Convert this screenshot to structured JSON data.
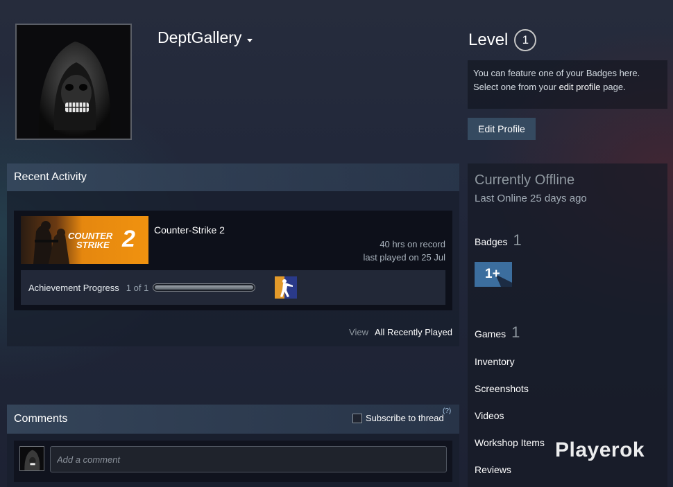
{
  "profile": {
    "persona_name": "DeptGallery",
    "level_label": "Level",
    "level_value": "1",
    "badge_info_line1": "You can feature one of your Badges here.",
    "badge_info_line2_pre": "Select one from your ",
    "badge_info_link": "edit profile",
    "badge_info_line2_post": " page.",
    "edit_profile_label": "Edit Profile"
  },
  "recent_activity": {
    "header": "Recent Activity",
    "game": {
      "name": "Counter-Strike 2",
      "hours": "40 hrs on record",
      "last_played": "last played on 25 Jul",
      "capsule_line1": "COUNTER",
      "capsule_line2": "STRIKE",
      "capsule_num": "2"
    },
    "achievement": {
      "label": "Achievement Progress",
      "count": "1 of 1",
      "progress": 1.0
    },
    "view_label": "View",
    "view_all_label": "All Recently Played"
  },
  "comments": {
    "header": "Comments",
    "subscribe_label": "Subscribe to thread",
    "help_mark": "(?)",
    "placeholder": "Add a comment"
  },
  "status": {
    "title": "Currently Offline",
    "last_online": "Last Online 25 days ago",
    "badges_label": "Badges",
    "badges_count": "1",
    "badge_tile_text": "1+",
    "games_label": "Games",
    "games_count": "1",
    "links": [
      "Inventory",
      "Screenshots",
      "Videos",
      "Workshop Items",
      "Reviews"
    ]
  },
  "watermark": "Playerok",
  "colors": {
    "background": "#21273a",
    "header_accent": "#4a627c",
    "button": "#354a60",
    "capsule_orange": "#f0920f",
    "badge_blue": "#3c6e9e"
  }
}
